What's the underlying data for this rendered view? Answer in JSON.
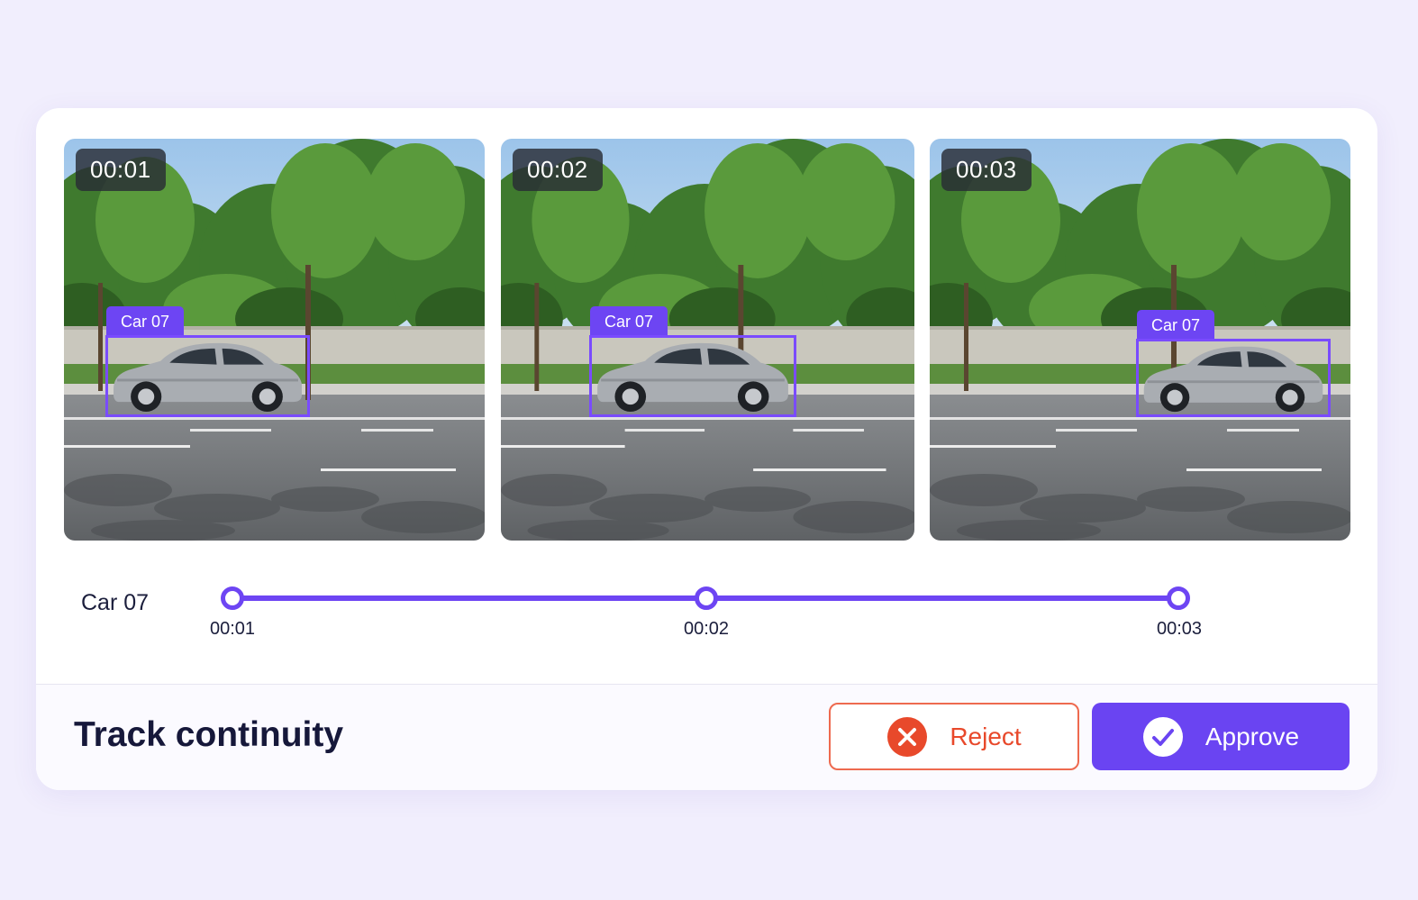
{
  "frames": [
    {
      "timestamp": "00:01",
      "object_label": "Car 07"
    },
    {
      "timestamp": "00:02",
      "object_label": "Car 07"
    },
    {
      "timestamp": "00:03",
      "object_label": "Car 07"
    }
  ],
  "track": {
    "label": "Car 07",
    "points": [
      "00:01",
      "00:02",
      "00:03"
    ]
  },
  "footer": {
    "title": "Track continuity",
    "reject_label": "Reject",
    "approve_label": "Approve"
  },
  "icons": {
    "reject": "close-circle-icon",
    "approve": "check-circle-icon"
  },
  "colors": {
    "accent": "#6d45f3",
    "reject": "#e8492b",
    "background": "#f1eefd"
  }
}
